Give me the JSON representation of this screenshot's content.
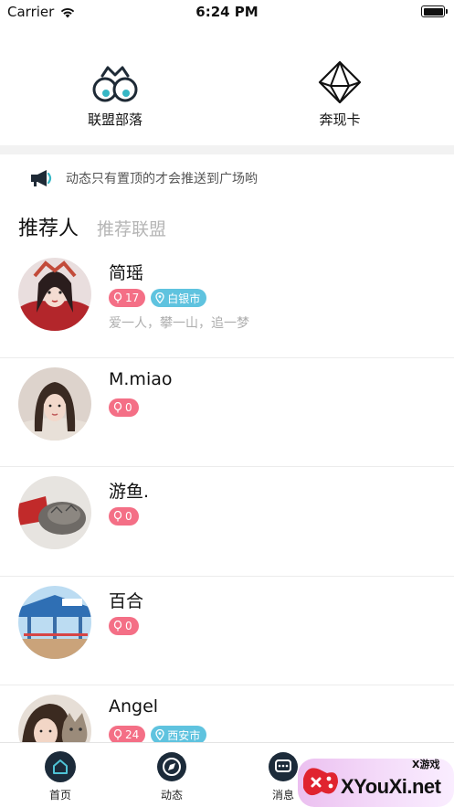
{
  "status_bar": {
    "carrier": "Carrier",
    "time": "6:24 PM"
  },
  "quick_links": [
    {
      "label": "联盟部落",
      "icon": "eyes-icon"
    },
    {
      "label": "奔现卡",
      "icon": "diamond-icon"
    }
  ],
  "notice": {
    "text": "动态只有置顶的才会推送到广场哟",
    "icon": "megaphone-icon"
  },
  "tabs": {
    "active": "推荐人",
    "inactive": "推荐联盟"
  },
  "users": [
    {
      "name": "简瑶",
      "count": "17",
      "city": "白银市",
      "bio": "爱一人，攀一山，追一梦"
    },
    {
      "name": "M.miao",
      "count": "0"
    },
    {
      "name": "游鱼.",
      "count": "0"
    },
    {
      "name": "百合",
      "count": "0"
    },
    {
      "name": "Angel",
      "count": "24",
      "city": "西安市"
    }
  ],
  "tab_bar": [
    {
      "label": "首页",
      "icon": "home-icon"
    },
    {
      "label": "动态",
      "icon": "compass-icon"
    },
    {
      "label": "消息",
      "icon": "message-icon"
    }
  ],
  "watermark": {
    "text": "XYouXi.net",
    "small": "X游戏"
  },
  "colors": {
    "pink_badge": "#f46f86",
    "teal_badge": "#5fc3df",
    "nav_dark": "#1c2b3a"
  }
}
